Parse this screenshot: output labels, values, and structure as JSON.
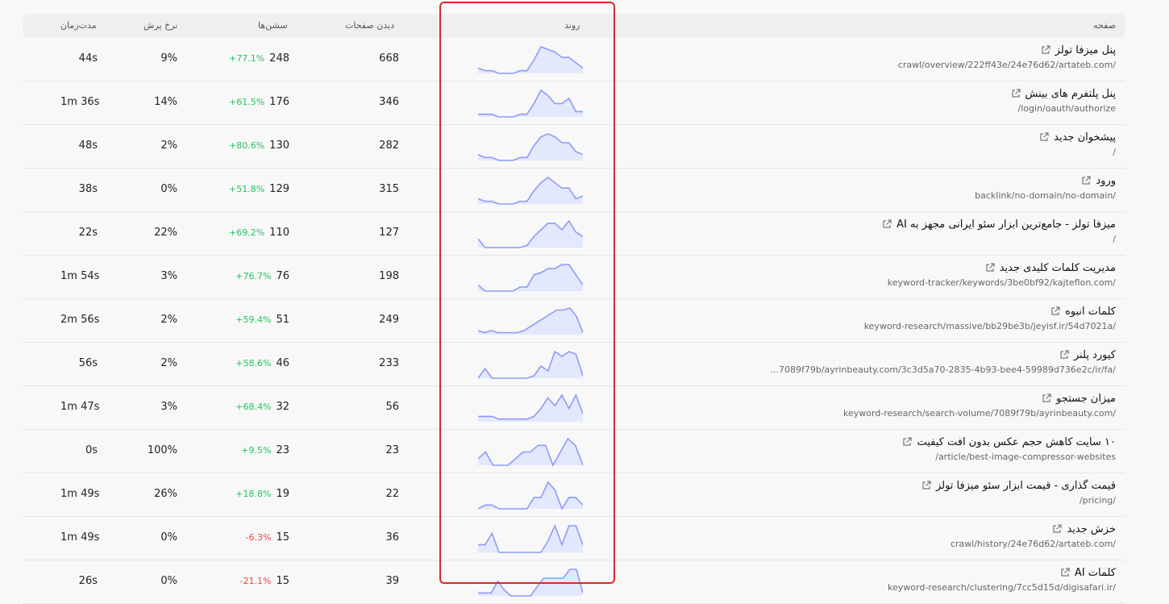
{
  "header": {
    "page": "صفحه",
    "trend": "روند",
    "pageviews": "دیدن صفحات",
    "sessions": "سشن‌ها",
    "bounce_rate": "نرخ پرش",
    "duration": "مدت‌زمان"
  },
  "colors": {
    "trend_line": "#8b9cf4",
    "trend_fill": "#e4e8fd",
    "positive": "#22c55e",
    "negative": "#ef4444",
    "highlight_border": "#dc2626"
  },
  "rows": [
    {
      "title": "پنل میزفا تولز",
      "url": "crawl/overview/222ff43e/24e76d62/artateb.com/",
      "pageviews": "668",
      "sessions": "248",
      "change": "+77.1%",
      "direction": "up",
      "bounce": "9%",
      "duration": "44s",
      "trend": [
        2,
        1,
        1,
        0,
        0,
        0,
        1,
        1,
        5,
        10,
        9,
        8,
        6,
        6,
        4,
        2
      ]
    },
    {
      "title": "پنل پلتفرم های بینش",
      "url": "/login/oauth/authorize",
      "pageviews": "346",
      "sessions": "176",
      "change": "+61.5%",
      "direction": "up",
      "bounce": "14%",
      "duration": "1m 36s",
      "trend": [
        1,
        1,
        1,
        0,
        0,
        0,
        1,
        1,
        5,
        10,
        8,
        5,
        5,
        7,
        2,
        2
      ]
    },
    {
      "title": "پیشخوان جدید",
      "url": "/",
      "pageviews": "282",
      "sessions": "130",
      "change": "+80.6%",
      "direction": "up",
      "bounce": "2%",
      "duration": "48s",
      "trend": [
        2,
        1,
        1,
        0,
        0,
        0,
        1,
        1,
        5,
        8,
        9,
        8,
        6,
        6,
        3,
        2
      ]
    },
    {
      "title": "ورود",
      "url": "backlink/no-domain/no-domain/",
      "pageviews": "315",
      "sessions": "129",
      "change": "+51.8%",
      "direction": "up",
      "bounce": "0%",
      "duration": "38s",
      "trend": [
        2,
        1,
        1,
        0,
        0,
        0,
        1,
        1,
        5,
        8,
        10,
        8,
        6,
        6,
        2,
        3
      ]
    },
    {
      "title": "میزفا تولز - جامع‌ترین ابزار سئو ایرانی مجهز به AI",
      "url": "/",
      "pageviews": "127",
      "sessions": "110",
      "change": "+69.2%",
      "direction": "up",
      "bounce": "22%",
      "duration": "22s",
      "trend": [
        4,
        0,
        0,
        0,
        0,
        0,
        0,
        1,
        5,
        8,
        11,
        11,
        8,
        12,
        7,
        5
      ]
    },
    {
      "title": "مدیریت کلمات کلیدی جدید",
      "url": "keyword-tracker/keywords/3be0bf92/kajteflon.com/",
      "pageviews": "198",
      "sessions": "76",
      "change": "+76.7%",
      "direction": "up",
      "bounce": "3%",
      "duration": "1m 54s",
      "trend": [
        3,
        0,
        0,
        0,
        0,
        0,
        2,
        2,
        8,
        9,
        11,
        11,
        13,
        13,
        8,
        3
      ]
    },
    {
      "title": "کلمات انبوه",
      "url": "keyword-research/massive/bb29be3b/jeyisf.ir/54d7021a/",
      "pageviews": "249",
      "sessions": "51",
      "change": "+59.4%",
      "direction": "up",
      "bounce": "2%",
      "duration": "2m 56s",
      "trend": [
        2,
        1,
        2,
        1,
        1,
        1,
        1,
        2,
        4,
        6,
        8,
        10,
        12,
        12,
        13,
        9,
        1
      ]
    },
    {
      "title": "کیورد پلنر",
      "url": "...7089f79b/ayrinbeauty.com/3c3d5a70-2835-4b93-bee4-59989d736e2c/ir/fa/",
      "pageviews": "233",
      "sessions": "46",
      "change": "+58.6%",
      "direction": "up",
      "bounce": "2%",
      "duration": "56s",
      "trend": [
        0,
        4,
        0,
        0,
        0,
        0,
        0,
        0,
        1,
        5,
        3,
        11,
        9,
        11,
        10,
        1
      ]
    },
    {
      "title": "میزان جستجو",
      "url": "keyword-research/search-volume/7089f79b/ayrinbeauty.com/",
      "pageviews": "56",
      "sessions": "32",
      "change": "+68.4%",
      "direction": "up",
      "bounce": "3%",
      "duration": "1m 47s",
      "trend": [
        2,
        2,
        2,
        1,
        1,
        1,
        1,
        1,
        2,
        5,
        9,
        6,
        10,
        5,
        10,
        3
      ]
    },
    {
      "title": "۱۰ سایت کاهش حجم عکس بدون افت کیفیت",
      "url": "/article/best-image-compressor-websites",
      "pageviews": "23",
      "sessions": "23",
      "change": "+9.5%",
      "direction": "up",
      "bounce": "100%",
      "duration": "0s",
      "trend": [
        2,
        4,
        0,
        0,
        0,
        2,
        4,
        4,
        6,
        6,
        0,
        4,
        8,
        6,
        0
      ]
    },
    {
      "title": "قیمت گذاری - قیمت ابزار سئو میزفا تولز",
      "url": "/pricing/",
      "pageviews": "22",
      "sessions": "19",
      "change": "+18.8%",
      "direction": "up",
      "bounce": "26%",
      "duration": "1m 49s",
      "trend": [
        0,
        1,
        1,
        0,
        0,
        0,
        0,
        0,
        3,
        3,
        7,
        5,
        0,
        3,
        3,
        1
      ]
    },
    {
      "title": "خزش جدید",
      "url": "crawl/history/24e76d62/artateb.com/",
      "pageviews": "36",
      "sessions": "15",
      "change": "-6.3%",
      "direction": "down",
      "bounce": "0%",
      "duration": "1m 49s",
      "trend": [
        2,
        2,
        5,
        0,
        0,
        0,
        0,
        0,
        0,
        0,
        3,
        7,
        2,
        7,
        7,
        2
      ]
    },
    {
      "title": "کلمات AI",
      "url": "keyword-research/clustering/7cc5d15d/digisafari.ir/",
      "pageviews": "39",
      "sessions": "15",
      "change": "-21.1%",
      "direction": "down",
      "bounce": "0%",
      "duration": "26s",
      "trend": [
        1,
        1,
        1,
        5,
        2,
        0,
        0,
        0,
        0,
        3,
        6,
        6,
        6,
        6,
        9,
        9,
        1
      ]
    }
  ]
}
